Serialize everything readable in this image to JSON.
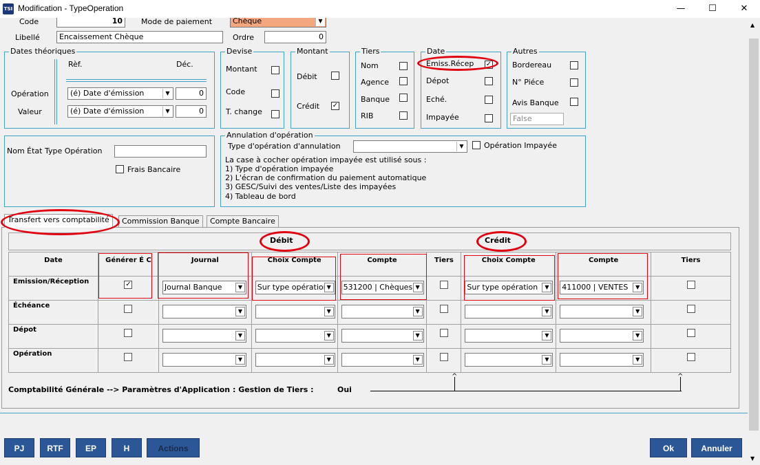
{
  "window": {
    "title": "Modification - TypeOperation",
    "minimize": "—",
    "maximize": "☐",
    "close": "✕"
  },
  "top": {
    "code_label": "Code",
    "code_value": "10",
    "mode_label": "Mode de paiement",
    "mode_value": "Chèque",
    "libelle_label": "Libellé",
    "libelle_value": "Encaissement Chèque",
    "ordre_label": "Ordre",
    "ordre_value": "0"
  },
  "dates": {
    "title": "Dates théoriques",
    "ref": "Rèf.",
    "dec": "Déc.",
    "operation_label": "Opération",
    "valeur_label": "Valeur",
    "operation_combo": "(é) Date d'émission",
    "valeur_combo": "(é) Date d'émission",
    "operation_num": "0",
    "valeur_num": "0"
  },
  "devise": {
    "title": "Devise",
    "montant": "Montant",
    "code": "Code",
    "tchange": "T. change"
  },
  "montant": {
    "title": "Montant",
    "debit": "Débit",
    "credit": "Crédit",
    "credit_check": "✓"
  },
  "tiers": {
    "title": "Tiers",
    "nom": "Nom",
    "agence": "Agence",
    "banque": "Banque",
    "rib": "RIB"
  },
  "date": {
    "title": "Date",
    "emiss": "Emiss.Récep",
    "emiss_check": "✓",
    "depot": "Dépot",
    "eche": "Eché.",
    "impayee": "Impayée"
  },
  "autres": {
    "title": "Autres",
    "bordereau": "Bordereau",
    "npiece": "N° Piéce",
    "avis": "Avis Banque",
    "false_value": "False"
  },
  "etat": {
    "nom_label": "Nom État Type Opération",
    "frais": "Frais Bancaire"
  },
  "annulation": {
    "title": "Annulation d'opération",
    "type_label": "Type d'opération d'annulation",
    "op_impayee": "Opération Impayée",
    "line1": "La case à cocher opération impayée est utilisé sous :",
    "line2": "1) Type d'opération impayée",
    "line3": "2) L'écran de confirmation du paiement automatique",
    "line4": "3) GESC/Suivi des ventes/Liste des impayées",
    "line5": "4) Tableau de bord"
  },
  "tabs": [
    "Transfert vers comptabilité",
    "Commission Banque",
    "Compte Bancaire"
  ],
  "grid": {
    "debit_header": "Débit",
    "credit_header": "Crédit",
    "headers": [
      "Date",
      "Générer É C",
      "Journal",
      "Choix Compte",
      "Compte",
      "Tiers",
      "Choix Compte",
      "Compte",
      "Tiers"
    ],
    "rows": [
      {
        "label": "Emission/Réception",
        "generer": "✓",
        "journal": "Journal Banque",
        "choix1": "Sur type opération",
        "compte1": "531200 | Chèques",
        "choix2": "Sur type opération",
        "compte2": "411000 | VENTES"
      },
      {
        "label": "Échéance",
        "generer": "",
        "journal": "",
        "choix1": "",
        "compte1": "",
        "choix2": "",
        "compte2": ""
      },
      {
        "label": "Dépot",
        "generer": "",
        "journal": "",
        "choix1": "",
        "compte1": "",
        "choix2": "",
        "compte2": ""
      },
      {
        "label": "Opération",
        "generer": "",
        "journal": "",
        "choix1": "",
        "compte1": "",
        "choix2": "",
        "compte2": ""
      }
    ]
  },
  "footer_note": {
    "text": "Comptabilité Générale --> Paramètres d'Application : Gestion de Tiers :",
    "value": "Oui"
  },
  "buttons": {
    "pj": "PJ",
    "rtf": "RTF",
    "ep": "EP",
    "h": "H",
    "actions": "Actions",
    "ok": "Ok",
    "annuler": "Annuler"
  },
  "colors": {
    "accent_button": "#2b5797",
    "group_border": "#3ea2c4",
    "annotation": "#e00010",
    "mode_highlight": "#f4a77f"
  }
}
